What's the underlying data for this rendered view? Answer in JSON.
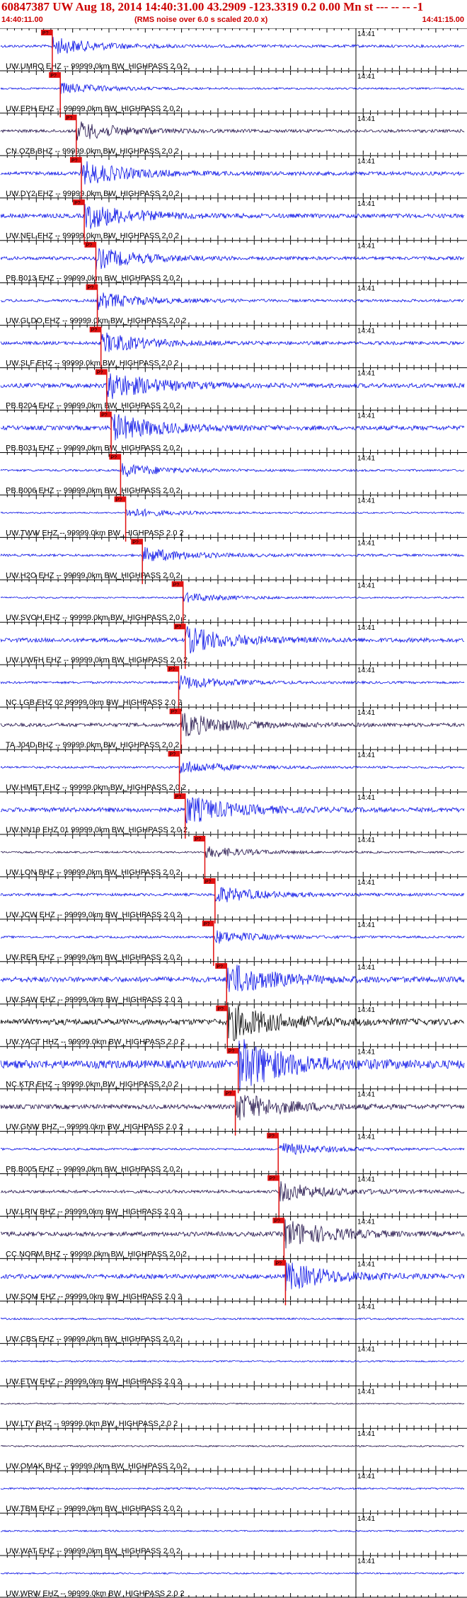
{
  "header": {
    "title": "60847387 UW Aug 18, 2014 14:40:31.00   43.2909 -123.3319  0.2 0.00 Mn st --- -- --  -1",
    "start_time": "14:40:11.00",
    "note": "(RMS noise over 6.0 s scaled 20.0 x)",
    "end_time": "14:41:15.00"
  },
  "chart_data": {
    "type": "line",
    "title": "60847387 UW Aug 18, 2014 14:40:31.00   43.2909 -123.3319  0.2 0.00 Mn st --- -- --  -1",
    "x_range_seconds": [
      0,
      64
    ],
    "x_start_label": "14:40:11.00",
    "x_end_label": "14:41:15.00",
    "minute_mark_label": "14:41",
    "minute_mark_seconds": 49,
    "pick_label": "P?",
    "colors": {
      "blue": "#0a12e6",
      "dark": "#22124a",
      "black": "#000000",
      "pick": "#e01010"
    },
    "traces": [
      {
        "label": "UW.UMPQ EHZ -- 99999.0km BW_HIGHPASS  2.0  2",
        "color": "blue",
        "pick_s": 7.2,
        "amp": 0.18
      },
      {
        "label": "UW.EPH EHZ -- 99999.0km BW_HIGHPASS  2.0  2",
        "color": "blue",
        "pick_s": 8.3,
        "amp": 0.12
      },
      {
        "label": "CN.OZB BHZ -- 99999.0km BW_HIGHPASS  2.0  2",
        "color": "dark",
        "pick_s": 10.5,
        "amp": 0.2
      },
      {
        "label": "UW.DY2 EHZ -- 99999.0km BW_HIGHPASS  2.0  2",
        "color": "blue",
        "pick_s": 11.2,
        "amp": 0.25
      },
      {
        "label": "UW.NEL EHZ -- 99999.0km BW_HIGHPASS  2.0  2",
        "color": "blue",
        "pick_s": 11.6,
        "amp": 0.28
      },
      {
        "label": "PB.B013 EHZ -- 99999.0km BW_HIGHPASS  2.0  2",
        "color": "blue",
        "pick_s": 13.2,
        "amp": 0.22
      },
      {
        "label": "UW.GLDO EHZ -- 99999.0km BW_HIGHPASS  2.0  2",
        "color": "blue",
        "pick_s": 13.4,
        "amp": 0.18
      },
      {
        "label": "UW.SLF EHZ -- 99999.0km BW_HIGHPASS  2.0  2",
        "color": "blue",
        "pick_s": 13.9,
        "amp": 0.22
      },
      {
        "label": "PB.B204 EHZ -- 99999.0km BW_HIGHPASS  2.0  2",
        "color": "blue",
        "pick_s": 14.7,
        "amp": 0.3
      },
      {
        "label": "PB.B031 EHZ -- 99999.0km BW_HIGHPASS  2.0  2",
        "color": "blue",
        "pick_s": 15.3,
        "amp": 0.3
      },
      {
        "label": "PB.B006 EHZ -- 99999.0km BW_HIGHPASS  2.0  2",
        "color": "blue",
        "pick_s": 16.6,
        "amp": 0.14
      },
      {
        "label": "UW.TWW EHZ -- 99999.0km BW_HIGHPASS  2.0  2",
        "color": "blue",
        "pick_s": 17.3,
        "amp": 0.1
      },
      {
        "label": "UW.H2O EHZ -- 99999.0km BW_HIGHPASS  2.0  2",
        "color": "blue",
        "pick_s": 19.6,
        "amp": 0.16
      },
      {
        "label": "UW.SVOH EHZ -- 99999.0km BW_HIGHPASS  2.0  2",
        "color": "blue",
        "pick_s": 25.2,
        "amp": 0.1
      },
      {
        "label": "UW.UWFH EHZ -- 99999.0km BW_HIGHPASS  2.0  2",
        "color": "blue",
        "pick_s": 25.5,
        "amp": 0.28
      },
      {
        "label": "NC.LGB EHZ 02 99999.0km BW_HIGHPASS  2.0  2",
        "color": "blue",
        "pick_s": 24.6,
        "amp": 0.15
      },
      {
        "label": "TA.J04D BHZ -- 99999.0km BW_HIGHPASS  2.0  2",
        "color": "dark",
        "pick_s": 24.9,
        "amp": 0.25
      },
      {
        "label": "UW.HMET EHZ -- 99999.0km BW_HIGHPASS  2.0  2",
        "color": "blue",
        "pick_s": 24.7,
        "amp": 0.14
      },
      {
        "label": "UW.NN19 EHZ 01 99999.0km BW_HIGHPASS  2.0  2",
        "color": "blue",
        "pick_s": 25.5,
        "amp": 0.3
      },
      {
        "label": "UW.LON BHZ -- 99999.0km BW_HIGHPASS  2.0  2",
        "color": "dark",
        "pick_s": 28.2,
        "amp": 0.12
      },
      {
        "label": "UW.JCW EHZ -- 99999.0km BW_HIGHPASS  2.0  2",
        "color": "blue",
        "pick_s": 29.6,
        "amp": 0.18
      },
      {
        "label": "UW.RER EHZ -- 99999.0km BW_HIGHPASS  2.0  2",
        "color": "blue",
        "pick_s": 29.4,
        "amp": 0.14
      },
      {
        "label": "UW.SAW EHZ -- 99999.0km BW_HIGHPASS  2.0  2",
        "color": "blue",
        "pick_s": 31.2,
        "amp": 0.35
      },
      {
        "label": "UW.YACT HHZ -- 99999.0km BW_HIGHPASS  2.0  2",
        "color": "black",
        "pick_s": 31.3,
        "amp": 0.4
      },
      {
        "label": "NC.KTR EHZ -- 99999.0km BW_HIGHPASS  2.0  2",
        "color": "blue",
        "pick_s": 32.8,
        "amp": 0.55
      },
      {
        "label": "UW.GNW BHZ -- 99999.0km BW_HIGHPASS  2.0  2",
        "color": "dark",
        "pick_s": 32.4,
        "amp": 0.3
      },
      {
        "label": "PB.B005 EHZ -- 99999.0km BW_HIGHPASS  2.0  2",
        "color": "blue",
        "pick_s": 38.3,
        "amp": 0.14
      },
      {
        "label": "UW.LRIV BHZ -- 99999.0km BW_HIGHPASS  2.0  2",
        "color": "dark",
        "pick_s": 38.4,
        "amp": 0.2
      },
      {
        "label": "CC.NORM BHZ -- 99999.0km BW_HIGHPASS  2.0  2",
        "color": "dark",
        "pick_s": 39.1,
        "amp": 0.3
      },
      {
        "label": "UW.SOM EHZ -- 99999.0km BW_HIGHPASS  2.0  2",
        "color": "blue",
        "pick_s": 39.3,
        "amp": 0.3
      },
      {
        "label": "UW.CBS EHZ -- 99999.0km BW_HIGHPASS  2.0  2",
        "color": "blue",
        "pick_s": null,
        "amp": 0.12
      },
      {
        "label": "UW.ETW EHZ -- 99999.0km BW_HIGHPASS  2.0  2",
        "color": "blue",
        "pick_s": null,
        "amp": 0.1
      },
      {
        "label": "UW.LTY BHZ -- 99999.0km BW_HIGHPASS  2.0  2",
        "color": "dark",
        "pick_s": null,
        "amp": 0.08
      },
      {
        "label": "UW.OMAK BHZ -- 99999.0km BW_HIGHPASS  2.0  2",
        "color": "dark",
        "pick_s": null,
        "amp": 0.1
      },
      {
        "label": "UW.TBM EHZ -- 99999.0km BW_HIGHPASS  2.0  2",
        "color": "blue",
        "pick_s": null,
        "amp": 0.12
      },
      {
        "label": "UW.WAT EHZ -- 99999.0km BW_HIGHPASS  2.0  2",
        "color": "blue",
        "pick_s": null,
        "amp": 0.1
      },
      {
        "label": "UW.WRW EHZ -- 99999.0km BW_HIGHPASS  2.0  2",
        "color": "blue",
        "pick_s": null,
        "amp": 0.1
      }
    ]
  }
}
